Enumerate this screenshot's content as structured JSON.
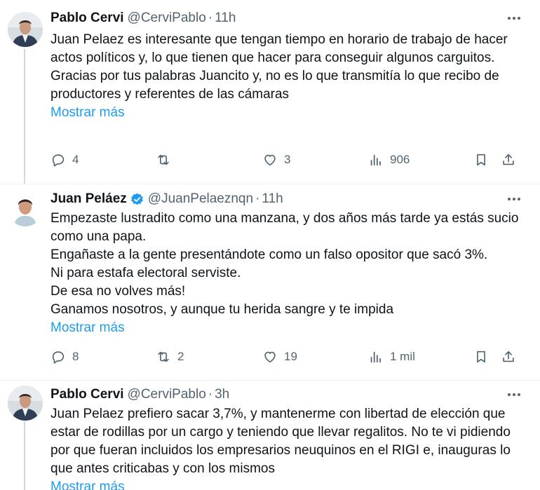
{
  "tweets": [
    {
      "author": "Pablo Cervi",
      "handle": "@CerviPablo",
      "dot": "·",
      "time": "11h",
      "lines": [
        "Juan Pelaez es interesante que tengan tiempo en horario de trabajo de hacer actos políticos y, lo que tienen que hacer para conseguir algunos carguitos.",
        "Gracias por tus palabras Juancito y, no es lo que transmitía lo que recibo de productores y referentes de las cámaras"
      ],
      "show_more": "Mostrar más",
      "replies": "4",
      "retweets": "",
      "likes": "3",
      "views": "906"
    },
    {
      "author": "Juan Peláez",
      "handle": "@JuanPelaeznqn",
      "dot": "·",
      "time": "11h",
      "lines": [
        "Empezaste lustradito como una manzana, y dos años más tarde ya estás sucio como una papa.",
        "Engañaste a la gente presentándote como un falso opositor que sacó 3%.",
        "Ni para estafa electoral serviste.",
        "De esa no volves más!",
        "Ganamos nosotros, y aunque tu herida sangre y te impida"
      ],
      "show_more": "Mostrar más",
      "replies": "8",
      "retweets": "2",
      "likes": "19",
      "views": "1 mil"
    },
    {
      "author": "Pablo Cervi",
      "handle": "@CerviPablo",
      "dot": "·",
      "time": "3h",
      "lines": [
        "Juan Pelaez prefiero sacar 3,7%, y mantenerme con libertad de elección que estar de rodillas por un cargo y teniendo que llevar regalitos. No te vi pidiendo por que fueran incluidos los empresarios neuquinos en el RIGI e, inauguras lo que antes criticabas y con los mismos"
      ],
      "show_more": "Mostrar más"
    }
  ],
  "colors": {
    "text": "#0f1419",
    "secondary": "#536471",
    "link": "#1d9bf0",
    "verified": "#1d9bf0",
    "thread_line": "#cfd9de"
  },
  "icons": [
    "reply-icon",
    "retweet-icon",
    "like-icon",
    "views-icon",
    "bookmark-icon",
    "share-icon",
    "more-icon",
    "verified-badge-icon"
  ]
}
